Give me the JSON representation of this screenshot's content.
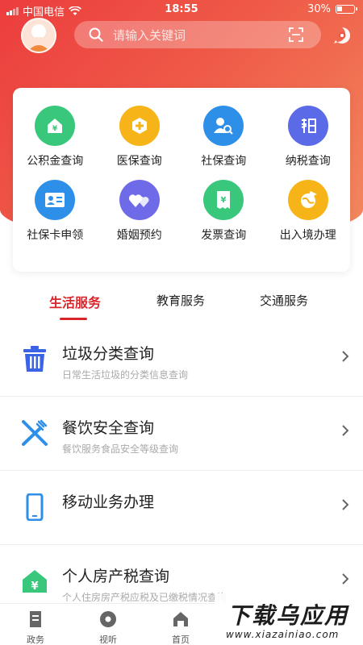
{
  "status_bar": {
    "carrier": "中国电信",
    "time": "18:55",
    "battery": "30%"
  },
  "header": {
    "search_placeholder": "请输入关键词"
  },
  "services": [
    {
      "label": "公积金查询",
      "icon": "house-yen-icon",
      "color": "#38c77b"
    },
    {
      "label": "医保查询",
      "icon": "medical-cross-icon",
      "color": "#f6b418"
    },
    {
      "label": "社保查询",
      "icon": "person-search-icon",
      "color": "#2e8fe8"
    },
    {
      "label": "纳税查询",
      "icon": "tax-character-icon",
      "color": "#5b6ae6"
    },
    {
      "label": "社保卡申领",
      "icon": "id-card-icon",
      "color": "#2e8fe8"
    },
    {
      "label": "婚姻预约",
      "icon": "hearts-icon",
      "color": "#6f6ae8"
    },
    {
      "label": "发票查询",
      "icon": "receipt-yen-icon",
      "color": "#38c77b"
    },
    {
      "label": "出入境办理",
      "icon": "globe-plane-icon",
      "color": "#f6b418"
    }
  ],
  "tabs": [
    {
      "label": "生活服务",
      "active": true
    },
    {
      "label": "教育服务",
      "active": false
    },
    {
      "label": "交通服务",
      "active": false
    }
  ],
  "list": [
    {
      "title": "垃圾分类查询",
      "subtitle": "日常生活垃圾的分类信息查询",
      "icon": "trash-can-icon",
      "color": "#3b63e6"
    },
    {
      "title": "餐饮安全查询",
      "subtitle": "餐饮服务食品安全等级查询",
      "icon": "fork-knife-icon",
      "color": "#2e8fe8"
    },
    {
      "title": "移动业务办理",
      "subtitle": "",
      "icon": "mobile-phone-icon",
      "color": "#2e8fe8"
    },
    {
      "title": "个人房产税查询",
      "subtitle": "个人住房房产税应税及已缴税情况查询",
      "icon": "house-yen-icon",
      "color": "#38c77b"
    }
  ],
  "bottom_nav": [
    {
      "label": "政务",
      "icon": "document-icon"
    },
    {
      "label": "视听",
      "icon": "disc-icon"
    },
    {
      "label": "首页",
      "icon": "home-icon"
    }
  ],
  "watermark": {
    "line1": "下载乌应用",
    "line2": "www.xiazainiao.com"
  },
  "colors": {
    "accent": "#d8252b",
    "hero_start": "#ec3d3d",
    "hero_end": "#f38a5f"
  }
}
